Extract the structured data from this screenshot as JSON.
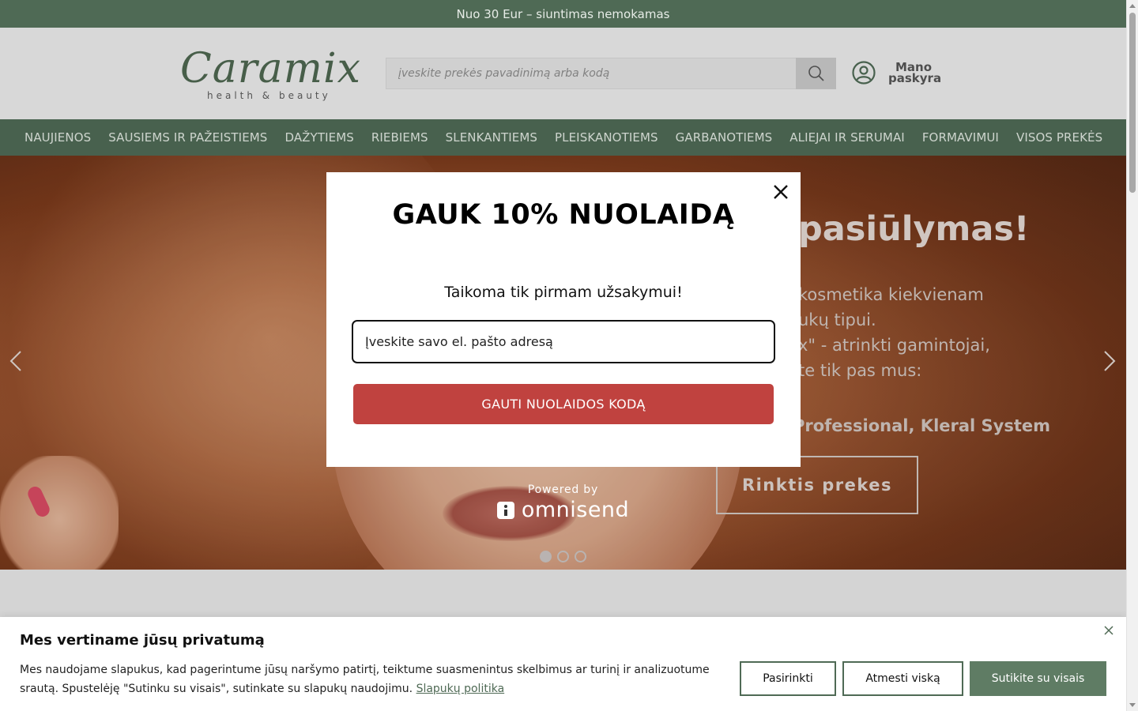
{
  "topbar": {
    "text": "Nuo 30 Eur – siuntimas nemokamas"
  },
  "header": {
    "logo_word": "Caramix",
    "logo_tagline": "health & beauty",
    "search_placeholder": "įveskite prekės pavadinimą arba kodą",
    "account_label": "Mano paskyra"
  },
  "nav": {
    "items": [
      "NAUJIENOS",
      "SAUSIEMS IR PAŽEISTIEMS",
      "DAŽYTIEMS",
      "RIEBIEMS",
      "SLENKANTIEMS",
      "PLEISKANOTIEMS",
      "GARBANOTIEMS",
      "ALIEJAI IR SERUMAI",
      "FORMAVIMUI",
      "VISOS PREKĖS"
    ]
  },
  "hero": {
    "title": "pasiūlymas!",
    "lines": [
      "kosmetika kiekvienam",
      "ukų tipui.",
      "x\" - atrinkti gamintojai,",
      "te tik pas mus:"
    ],
    "brands_prefix": "Professional, ",
    "brands_suffix": "Kleral System",
    "button": "Rinktis prekes",
    "slides_total": 3,
    "slide_active": 1
  },
  "popup": {
    "title": "GAUK 10% NUOLAIDĄ",
    "subtitle": "Taikoma tik pirmam užsakymui!",
    "email_placeholder": "Įveskite savo el. pašto adresą",
    "cta": "GAUTI NUOLAIDOS KODĄ",
    "powered_by": "Powered by",
    "powered_brand": "omnisend"
  },
  "cookie": {
    "title": "Mes vertiname jūsų privatumą",
    "text": "Mes naudojame slapukus, kad pagerintume jūsų naršymo patirtį, teiktume suasmenintus skelbimus ar turinį ir analizuotume srautą. Spustelėję \"Sutinku su visais\", sutinkate su slapukų naudojimu.",
    "policy_link": "Slapukų politika",
    "btn_customize": "Pasirinkti",
    "btn_reject": "Atmesti viską",
    "btn_accept": "Sutikite su visais"
  },
  "colors": {
    "brand_green": "#4f6a55",
    "accept_green": "#5f7c64",
    "cta_red": "#c0423f"
  },
  "icons": [
    "search-icon",
    "user-circle-icon",
    "close-icon",
    "chevron-left-icon",
    "chevron-right-icon",
    "omnisend-icon"
  ]
}
